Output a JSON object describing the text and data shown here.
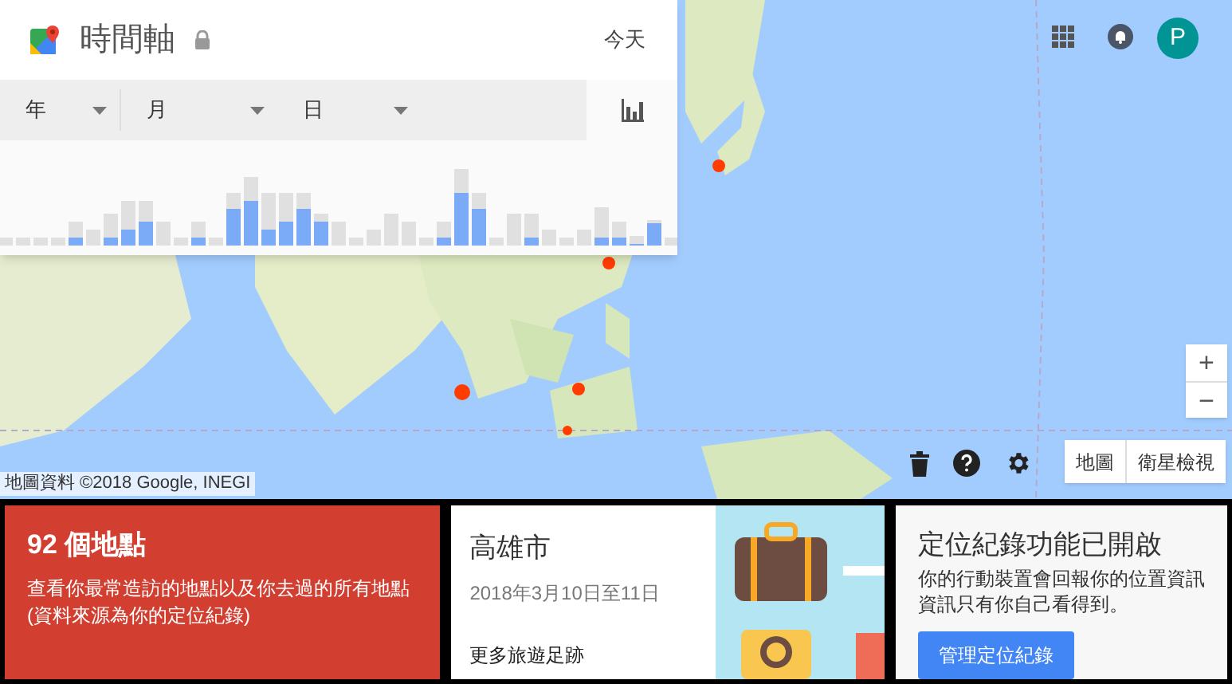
{
  "header": {
    "title": "時間軸",
    "today_link": "今天"
  },
  "filters": [
    {
      "label": "年"
    },
    {
      "label": "月"
    },
    {
      "label": "日"
    }
  ],
  "account": {
    "avatar_letter": "P"
  },
  "map": {
    "attribution": "地圖資料 ©2018 Google, INEGI",
    "zoom_in": "+",
    "zoom_out": "−",
    "map_types": [
      {
        "label": "地圖"
      },
      {
        "label": "衛星檢視"
      }
    ]
  },
  "cards": [
    {
      "kind": "places",
      "title": "92 個地點",
      "description": "查看你最常造訪的地點以及你去過的所有地點(資料來源為你的定位紀錄)"
    },
    {
      "kind": "trip",
      "title": "高雄市",
      "date": "2018年3月10日至11日",
      "link": "更多旅遊足跡"
    },
    {
      "kind": "history",
      "title": "定位紀錄功能已開啟",
      "lines": [
        "你的行動裝置會回報你的位置資訊",
        "資訊只有你自己看得到。"
      ],
      "button": "管理定位紀錄"
    }
  ]
}
